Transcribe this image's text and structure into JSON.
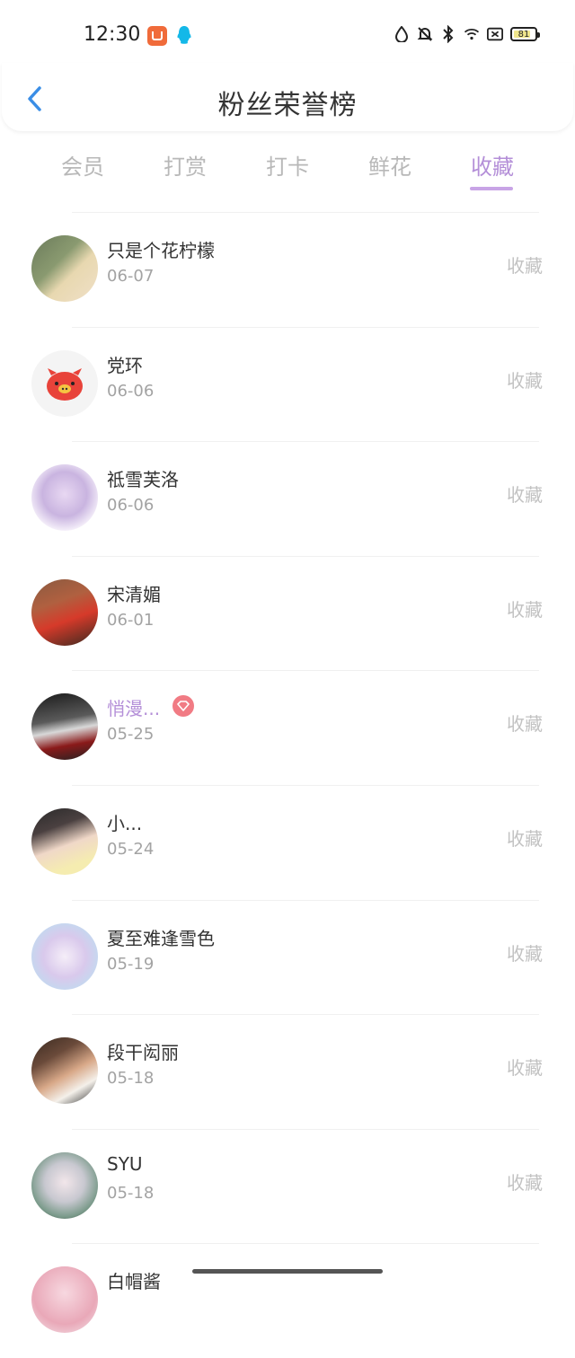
{
  "status_bar": {
    "time": "12:30",
    "battery": "81"
  },
  "header": {
    "title": "粉丝荣誉榜"
  },
  "tabs": [
    {
      "label": "会员",
      "active": false
    },
    {
      "label": "打赏",
      "active": false
    },
    {
      "label": "打卡",
      "active": false
    },
    {
      "label": "鲜花",
      "active": false
    },
    {
      "label": "收藏",
      "active": true
    }
  ],
  "fans": [
    {
      "name": "只是个花柠檬",
      "date": "06-07",
      "action": "收藏"
    },
    {
      "name": "党环",
      "date": "06-06",
      "action": "收藏"
    },
    {
      "name": "祗雪芙洛",
      "date": "06-06",
      "action": "收藏"
    },
    {
      "name": "宋清媚",
      "date": "06-01",
      "action": "收藏"
    },
    {
      "name": "悄漫...",
      "date": "05-25",
      "action": "收藏",
      "vip": true
    },
    {
      "name": "小...",
      "date": "05-24",
      "action": "收藏"
    },
    {
      "name": "夏至难逢雪色",
      "date": "05-19",
      "action": "收藏"
    },
    {
      "name": "段干闳丽",
      "date": "05-18",
      "action": "收藏"
    },
    {
      "name": "SYU",
      "date": "05-18",
      "action": "收藏"
    },
    {
      "name": "白帽酱",
      "date": "",
      "action": ""
    }
  ],
  "colors": {
    "accent": "#b48fd8",
    "vip_badge": "#f17b84",
    "back_icon": "#3a8ee6"
  }
}
